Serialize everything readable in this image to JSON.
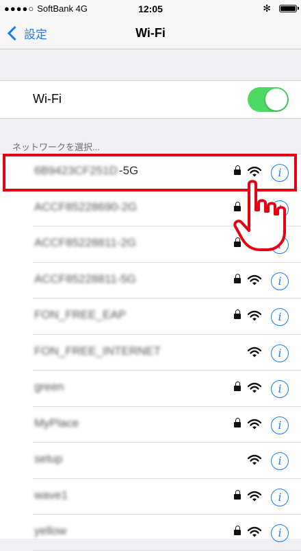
{
  "status_bar": {
    "signal_dots": "●●●●○",
    "carrier": "SoftBank",
    "network": "4G",
    "time": "12:05",
    "bluetooth": "✻"
  },
  "nav": {
    "back_label": "設定",
    "title": "Wi-Fi"
  },
  "wifi_toggle": {
    "label": "Wi-Fi",
    "state": "on",
    "on_color": "#4cd964"
  },
  "section_header": "ネットワークを選択...",
  "networks": [
    {
      "name": "6B9423CF251D",
      "suffix": "-5G",
      "locked": true,
      "highlighted": true
    },
    {
      "name": "ACCF85228690-2G",
      "locked": true
    },
    {
      "name": "ACCF85228811-2G",
      "locked": true
    },
    {
      "name": "ACCF85228811-5G",
      "locked": true
    },
    {
      "name": "FON_FREE_EAP",
      "locked": true
    },
    {
      "name": "FON_FREE_INTERNET",
      "locked": false
    },
    {
      "name": "green",
      "locked": true
    },
    {
      "name": "MyPlace",
      "locked": true
    },
    {
      "name": "setup",
      "locked": false
    },
    {
      "name": "wave1",
      "locked": true
    },
    {
      "name": "yellow",
      "locked": true
    }
  ],
  "colors": {
    "accent": "#1a7cfa",
    "highlight": "#e60012"
  },
  "icons": {
    "back": "chevron-left-icon",
    "lock": "lock-icon",
    "wifi": "wifi-signal-icon",
    "info": "info-icon",
    "pointer": "pointing-hand-icon"
  }
}
